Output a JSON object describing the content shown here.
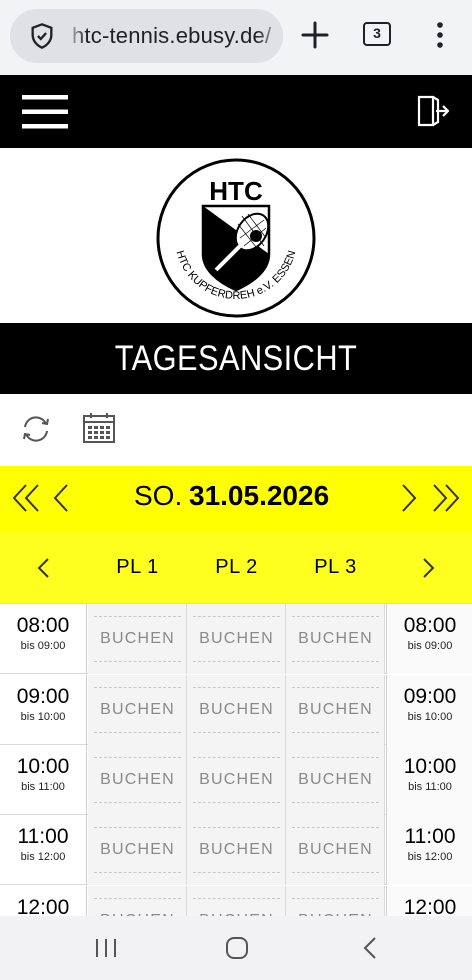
{
  "browser": {
    "url": "htc-tennis.ebusy.de/",
    "tab_count": "3"
  },
  "header": {
    "logo": {
      "initials": "HTC",
      "ring_text": "HTC KUPFERDREH e.V. ESSEN"
    }
  },
  "page": {
    "title": "TAGESANSICHT"
  },
  "date": {
    "weekday": "SO.",
    "value": "31.05.2026"
  },
  "courts": [
    "PL 1",
    "PL 2",
    "PL 3"
  ],
  "slot_label": "BUCHEN",
  "rows": [
    {
      "start": "08:00",
      "end": "bis 09:00"
    },
    {
      "start": "09:00",
      "end": "bis 10:00"
    },
    {
      "start": "10:00",
      "end": "bis 11:00"
    },
    {
      "start": "11:00",
      "end": "bis 12:00"
    },
    {
      "start": "12:00",
      "end": ""
    }
  ],
  "icons": {
    "browser": [
      "shield-icon",
      "plus-icon",
      "tabs-icon",
      "more-vert-icon"
    ],
    "toolbar": [
      "menu-icon",
      "logout-icon"
    ],
    "tools": [
      "refresh-icon",
      "calendar-icon"
    ],
    "date_nav": [
      "double-chevron-left-icon",
      "chevron-left-icon",
      "chevron-right-icon",
      "double-chevron-right-icon"
    ],
    "court_nav": [
      "chevron-left-icon",
      "chevron-right-icon"
    ],
    "system_nav": [
      "recents-icon",
      "home-icon",
      "back-icon"
    ]
  },
  "colors": {
    "header_bg": "#000000",
    "accent_yellow": "#ffff00",
    "slot_text": "#8a8a8a"
  }
}
